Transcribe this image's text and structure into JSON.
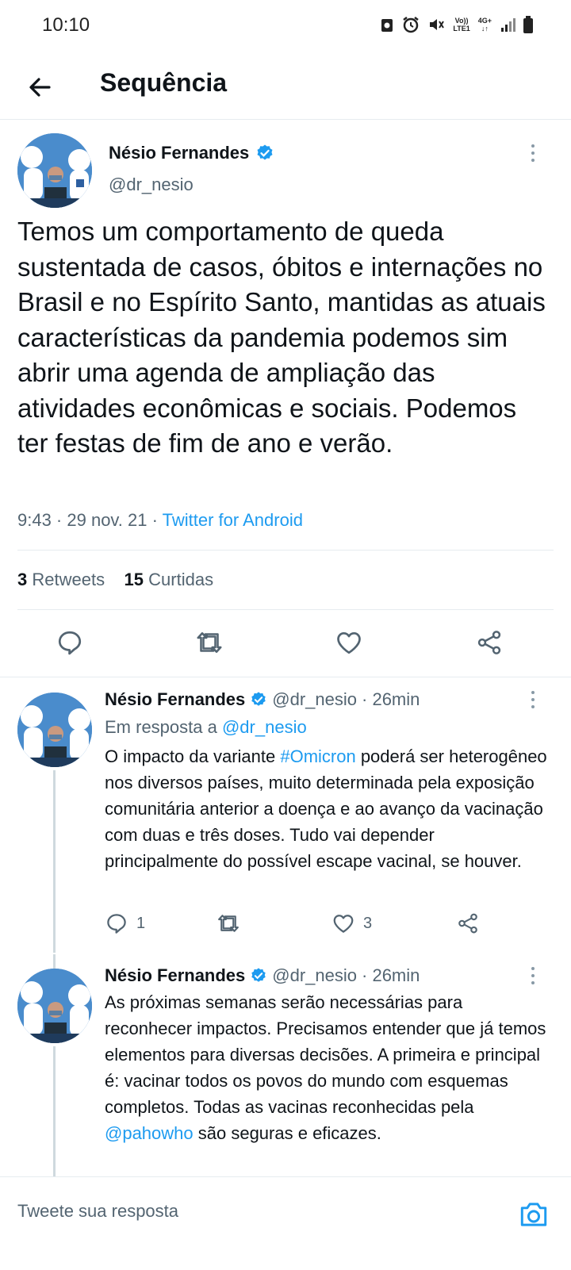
{
  "status_bar": {
    "time": "10:10",
    "network": "4G+",
    "lte": "LTE1",
    "volte": "Vo))"
  },
  "header": {
    "title": "Sequência"
  },
  "main_tweet": {
    "author_name": "Nésio Fernandes",
    "handle": "@dr_nesio",
    "text": "Temos um comportamento de queda sustentada de casos, óbitos e internações no Brasil e no Espírito Santo, mantidas as atuais características da pandemia podemos sim abrir uma agenda de ampliação das atividades econômicas e sociais. Podemos ter festas de fim de ano e verão.",
    "time_date": "9:43 · 29 nov. 21 · ",
    "source": "Twitter for Android",
    "retweets_count": "3",
    "retweets_label": "Retweets",
    "likes_count": "15",
    "likes_label": "Curtidas"
  },
  "replies": [
    {
      "author_name": "Nésio Fernandes",
      "handle": "@dr_nesio",
      "age": "· 26min",
      "reply_to_label": "Em resposta a",
      "reply_to_handle": "@dr_nesio",
      "text_before": "O impacto da variante ",
      "hashtag": "#Omicron",
      "text_after": " poderá ser heterogêneo nos diversos países, muito determinada pela exposição comunitária anterior a doença e ao avanço da vacinação com duas e três doses. Tudo vai depender principalmente do possível escape vacinal, se houver.",
      "reply_count": "1",
      "retweet_count": "",
      "like_count": "3"
    },
    {
      "author_name": "Nésio Fernandes",
      "handle": "@dr_nesio",
      "age": "· 26min",
      "text_before": "As próximas semanas serão necessárias para reconhecer impactos. Precisamos entender que já temos elementos para diversas decisões. A primeira e principal é: vacinar todos os povos do mundo com esquemas completos. Todas as vacinas reconhecidas pela ",
      "mention": "@pahowho",
      "text_after": " são seguras e eficazes."
    }
  ],
  "compose": {
    "placeholder": "Tweete sua resposta"
  },
  "colors": {
    "accent": "#1d9bf0",
    "text": "#0f1419",
    "secondary": "#536471",
    "divider": "#e6ecf0"
  },
  "icons": [
    "back-arrow-icon",
    "verified-badge-icon",
    "more-options-icon",
    "reply-icon",
    "retweet-icon",
    "like-icon",
    "share-icon",
    "camera-icon"
  ]
}
